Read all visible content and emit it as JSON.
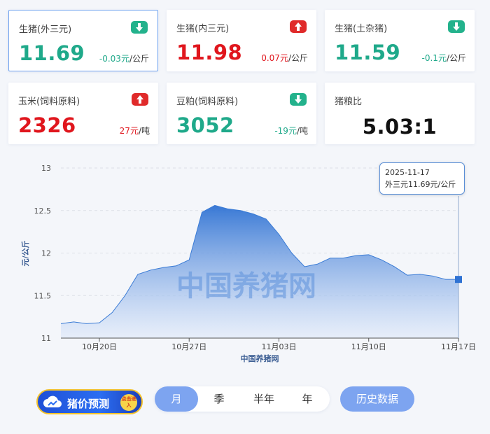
{
  "cards": [
    {
      "name": "生猪(外三元)",
      "price": "11.69",
      "change": "-0.03元",
      "unit": "/公斤",
      "trend": "down",
      "selected": true
    },
    {
      "name": "生猪(内三元)",
      "price": "11.98",
      "change": "0.07元",
      "unit": "/公斤",
      "trend": "up"
    },
    {
      "name": "生猪(土杂猪)",
      "price": "11.59",
      "change": "-0.1元",
      "unit": "/公斤",
      "trend": "down"
    },
    {
      "name": "玉米(饲料原料)",
      "price": "2326",
      "change": "27元",
      "unit": "/吨",
      "trend": "up"
    },
    {
      "name": "豆粕(饲料原料)",
      "price": "3052",
      "change": "-19元",
      "unit": "/吨",
      "trend": "down"
    },
    {
      "name": "猪粮比",
      "price": "5.03:1",
      "change": "",
      "unit": "",
      "trend": "none"
    }
  ],
  "colors": {
    "down": "#1fa98a",
    "up": "#e0161d",
    "accent": "#7da4f0",
    "line": "#3a7bd5"
  },
  "chart_data": {
    "type": "area",
    "ylabel": "元/公斤",
    "xlabel": "中国养猪网",
    "watermark": "中国养猪网",
    "ylim": [
      11,
      13
    ],
    "yticks": [
      "11",
      "11.5",
      "12",
      "12.5",
      "13"
    ],
    "xticks": [
      {
        "label": "10月20日",
        "index": 3
      },
      {
        "label": "10月27日",
        "index": 10
      },
      {
        "label": "11月03日",
        "index": 17
      },
      {
        "label": "11月10日",
        "index": 24
      },
      {
        "label": "11月17日",
        "index": 31
      }
    ],
    "x": [
      "10-17",
      "10-18",
      "10-19",
      "10-20",
      "10-21",
      "10-22",
      "10-23",
      "10-24",
      "10-25",
      "10-26",
      "10-27",
      "10-28",
      "10-29",
      "10-30",
      "10-31",
      "11-01",
      "11-02",
      "11-03",
      "11-04",
      "11-05",
      "11-06",
      "11-07",
      "11-08",
      "11-09",
      "11-10",
      "11-11",
      "11-12",
      "11-13",
      "11-14",
      "11-15",
      "11-16",
      "11-17"
    ],
    "series": [
      {
        "values": [
          11.17,
          11.19,
          11.17,
          11.18,
          11.3,
          11.5,
          11.75,
          11.8,
          11.83,
          11.85,
          11.92,
          12.48,
          12.56,
          12.52,
          12.5,
          12.46,
          12.4,
          12.22,
          12.0,
          11.84,
          11.87,
          11.94,
          11.94,
          11.97,
          11.98,
          11.92,
          11.84,
          11.74,
          11.75,
          11.73,
          11.69,
          11.69
        ]
      }
    ],
    "tooltip": {
      "date": "2025-11-17",
      "label": "外三元",
      "value": "11.69元/公斤"
    }
  },
  "controls": {
    "forecast": "猪价预测",
    "forecast_tag": "点击进入",
    "periods": [
      "月",
      "季",
      "半年",
      "年"
    ],
    "active_period": "月",
    "history": "历史数据"
  }
}
